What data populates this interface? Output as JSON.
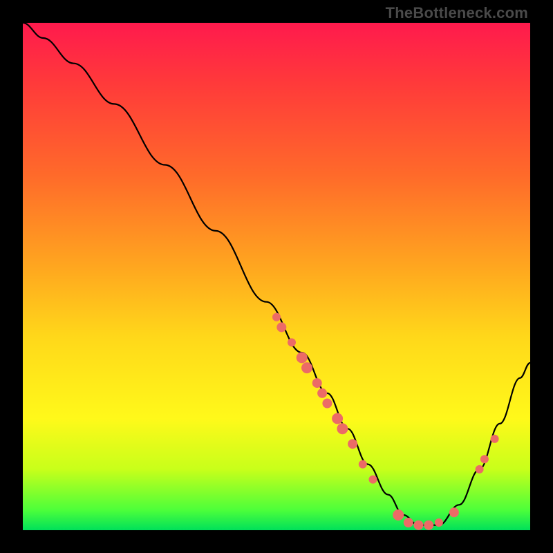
{
  "watermark": "TheBottleneck.com",
  "chart_data": {
    "type": "line",
    "title": "",
    "xlabel": "",
    "ylabel": "",
    "x_range": [
      0,
      100
    ],
    "y_range": [
      0,
      100
    ],
    "series": [
      {
        "name": "bottleneck-curve",
        "x": [
          0,
          4,
          10,
          18,
          28,
          38,
          48,
          55,
          60,
          64,
          68,
          72,
          75,
          78,
          82,
          86,
          90,
          94,
          98,
          100
        ],
        "y": [
          100,
          97,
          92,
          84,
          72,
          59,
          45,
          35,
          27,
          20,
          13,
          7,
          3,
          1,
          1,
          5,
          12,
          21,
          30,
          33
        ]
      }
    ],
    "markers": [
      {
        "x": 50,
        "y": 42,
        "r": 6
      },
      {
        "x": 51,
        "y": 40,
        "r": 7
      },
      {
        "x": 53,
        "y": 37,
        "r": 6
      },
      {
        "x": 55,
        "y": 34,
        "r": 8
      },
      {
        "x": 56,
        "y": 32,
        "r": 8
      },
      {
        "x": 58,
        "y": 29,
        "r": 7
      },
      {
        "x": 59,
        "y": 27,
        "r": 7
      },
      {
        "x": 60,
        "y": 25,
        "r": 7
      },
      {
        "x": 62,
        "y": 22,
        "r": 8
      },
      {
        "x": 63,
        "y": 20,
        "r": 8
      },
      {
        "x": 65,
        "y": 17,
        "r": 7
      },
      {
        "x": 67,
        "y": 13,
        "r": 6
      },
      {
        "x": 69,
        "y": 10,
        "r": 6
      },
      {
        "x": 74,
        "y": 3,
        "r": 8
      },
      {
        "x": 76,
        "y": 1.5,
        "r": 7
      },
      {
        "x": 78,
        "y": 1,
        "r": 7
      },
      {
        "x": 80,
        "y": 1,
        "r": 7
      },
      {
        "x": 82,
        "y": 1.5,
        "r": 6
      },
      {
        "x": 85,
        "y": 3.5,
        "r": 7
      },
      {
        "x": 90,
        "y": 12,
        "r": 6
      },
      {
        "x": 91,
        "y": 14,
        "r": 6
      },
      {
        "x": 93,
        "y": 18,
        "r": 6
      }
    ],
    "gradient_stops": [
      {
        "pos": 0.0,
        "color": "#ff1a4d"
      },
      {
        "pos": 0.12,
        "color": "#ff3a3a"
      },
      {
        "pos": 0.3,
        "color": "#ff6a2a"
      },
      {
        "pos": 0.48,
        "color": "#ffa61f"
      },
      {
        "pos": 0.62,
        "color": "#ffd81a"
      },
      {
        "pos": 0.78,
        "color": "#fff91a"
      },
      {
        "pos": 0.88,
        "color": "#c8ff1a"
      },
      {
        "pos": 0.96,
        "color": "#4dff3a"
      },
      {
        "pos": 1.0,
        "color": "#00e05a"
      }
    ]
  }
}
